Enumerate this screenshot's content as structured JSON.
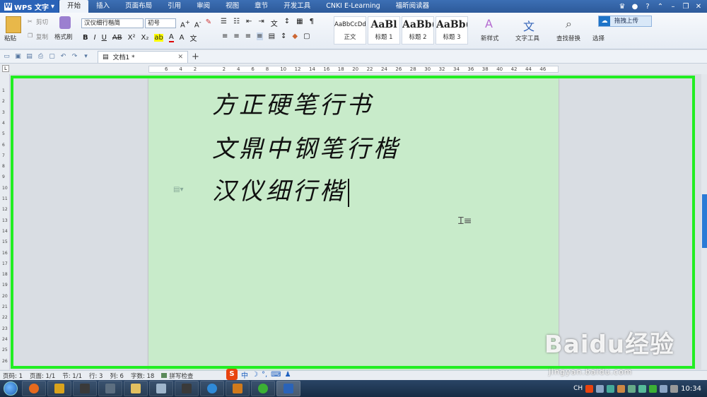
{
  "app": {
    "name": "WPS 文字"
  },
  "menu_tabs": [
    "开始",
    "插入",
    "页面布局",
    "引用",
    "审阅",
    "视图",
    "章节",
    "开发工具",
    "CNKI E-Learning",
    "福昕阅读器"
  ],
  "active_tab": "开始",
  "ribbon": {
    "paste": "粘贴",
    "cut": "剪切",
    "copy": "复制",
    "format_painter": "格式刷",
    "font_name": "汉仪细行楷简",
    "font_size": "初号",
    "styles": [
      {
        "preview": "AaBbCcDd",
        "label": "正文"
      },
      {
        "preview": "AaBl",
        "label": "标题 1"
      },
      {
        "preview": "AaBb(",
        "label": "标题 2"
      },
      {
        "preview": "AaBb(",
        "label": "标题 3"
      }
    ],
    "new_style": "新样式",
    "text_tools": "文字工具",
    "find_replace": "查找替换",
    "select": "选择",
    "upload": "拖拽上传"
  },
  "document_tab": {
    "name": "文档1 *"
  },
  "ruler": {
    "marks": [
      "6",
      "4",
      "2",
      "",
      "2",
      "4",
      "6",
      "8",
      "10",
      "12",
      "14",
      "16",
      "18",
      "20",
      "22",
      "24",
      "26",
      "28",
      "30",
      "32",
      "34",
      "36",
      "38",
      "40",
      "42",
      "44",
      "46"
    ]
  },
  "vruler": {
    "marks": [
      "1",
      "2",
      "3",
      "4",
      "5",
      "6",
      "7",
      "8",
      "9",
      "10",
      "11",
      "12",
      "13",
      "14",
      "15",
      "16",
      "17",
      "18",
      "19",
      "20",
      "21",
      "22",
      "23",
      "24",
      "25",
      "26"
    ]
  },
  "document": {
    "lines": [
      "方正硬笔行书",
      "文鼎中钢笔行楷",
      "汉仪细行楷"
    ]
  },
  "status": {
    "page": "页码: 1",
    "pages": "页面: 1/1",
    "section": "节: 1/1",
    "row": "行: 3",
    "col": "列: 6",
    "words": "字数: 18",
    "spell": "拼写检查"
  },
  "ime": {
    "mode": "中"
  },
  "tray": {
    "lang": "CH",
    "time": "10:34"
  },
  "watermark": {
    "logo": "Baidu经验",
    "site": "jingyan.baidu.com"
  },
  "colors": {
    "highlight_frame": "#22ee22",
    "page_bg": "#c8ebca",
    "titlebar": "#2d5a9a"
  }
}
